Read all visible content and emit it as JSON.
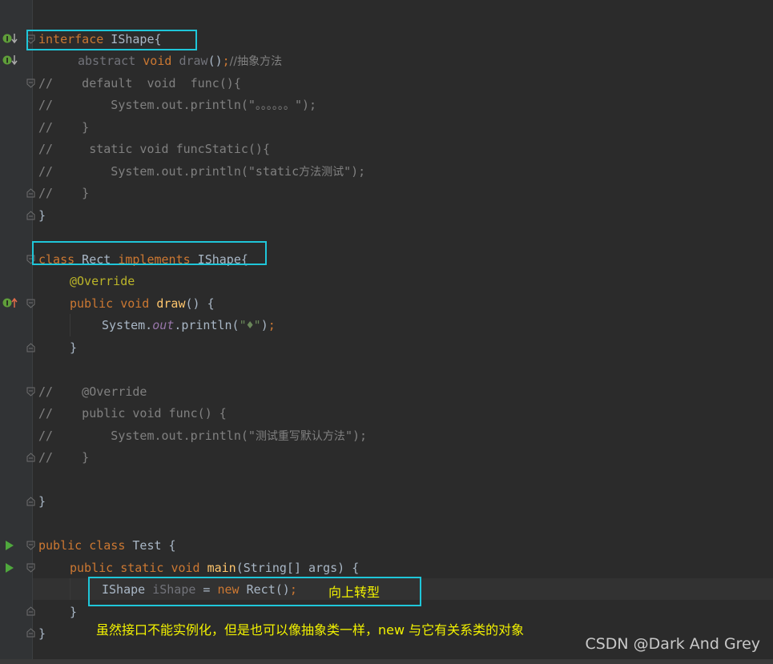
{
  "editor": {
    "lines": {
      "l1": {
        "kw": "interface",
        "text": " IShape{"
      },
      "l2": {
        "kw1": "abstract",
        "kw2": "void",
        "name": "draw",
        "punct": "()",
        "semi": ";",
        "comment": "//抽象方法"
      },
      "l3": "//    default  void  func(){",
      "l4a": "//        System.out.println(\"",
      "l4b": "。。。。。。",
      "l4c": "\");",
      "l5": "//    }",
      "l6": "//     static void funcStatic(){",
      "l7a": "//        System.out.println(\"static",
      "l7b": "方法测试",
      "l7c": "\");",
      "l8": "//    }",
      "l9": "}",
      "l11": {
        "kw1": "class",
        "name": " Rect ",
        "kw2": "implements",
        "rest": " IShape{"
      },
      "l12": "@Override",
      "l13": {
        "kw1": "public",
        "kw2": "void",
        "name": "draw",
        "rest": "() {"
      },
      "l14": {
        "obj": "System.",
        "field": "out",
        "method": ".println(",
        "str": "\"♦\"",
        "end": ")",
        "semi": ";"
      },
      "l15": "}",
      "l17": "//    @Override",
      "l18": "//    public void func() {",
      "l19a": "//        System.out.println(\"",
      "l19b": "测试重写默认方法",
      "l19c": "\");",
      "l20": "//    }",
      "l22": "}",
      "l24": {
        "kw1": "public",
        "kw2": "class",
        "rest": " Test {"
      },
      "l25": {
        "kw1": "public",
        "kw2": "static",
        "kw3": "void",
        "name": "main",
        "rest": "(String[] args) {"
      },
      "l26": {
        "type": "IShape ",
        "var": "iShape",
        "eq": " = ",
        "kw": "new",
        "rest": " Rect()",
        "semi": ";"
      },
      "l27": "}",
      "l28": "}"
    }
  },
  "annotations": {
    "upcast_label": "向上转型",
    "note": "虽然接口不能实例化，但是也可以像抽象类一样，new 与它有关系类的对象"
  },
  "watermark": "CSDN @Dark And Grey",
  "colors": {
    "background": "#2b2b2b",
    "highlight_box": "#1fc6d9",
    "annotation_text": "#f2f200",
    "keyword": "#cc7832",
    "function": "#ffc66d",
    "string": "#6a8759",
    "comment": "#808080"
  },
  "icons": {
    "implemented": "implemented-interface-icon",
    "implementing": "implementing-method-icon",
    "run": "run-icon",
    "fold": "fold-marker-icon"
  }
}
